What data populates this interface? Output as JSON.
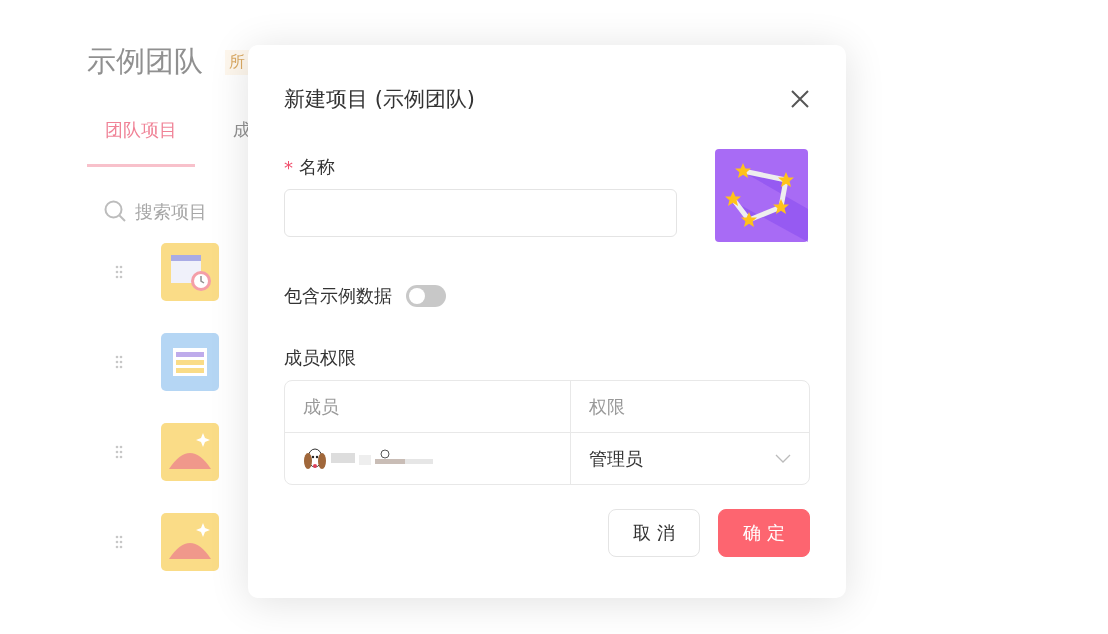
{
  "page": {
    "title": "示例团队",
    "badge": "所",
    "tabs": [
      {
        "label": "团队项目",
        "selected": true
      },
      {
        "label": "成",
        "selected": false
      }
    ],
    "search": {
      "placeholder": "搜索项目"
    },
    "projects": [
      {
        "kind": "calendar"
      },
      {
        "kind": "book"
      },
      {
        "kind": "landscape"
      },
      {
        "kind": "landscape"
      }
    ]
  },
  "dialog": {
    "title": "新建项目 (示例团队)",
    "name_field": {
      "label": "名称",
      "required_mark": "*"
    },
    "sample_data": {
      "label": "包含示例数据",
      "on": false
    },
    "permissions": {
      "label": "成员权限",
      "columns": [
        "成员",
        "权限"
      ],
      "rows": [
        {
          "role": "管理员"
        }
      ]
    },
    "buttons": [
      {
        "label": "取 消",
        "kind": "secondary"
      },
      {
        "label": "确 定",
        "kind": "primary"
      }
    ]
  }
}
